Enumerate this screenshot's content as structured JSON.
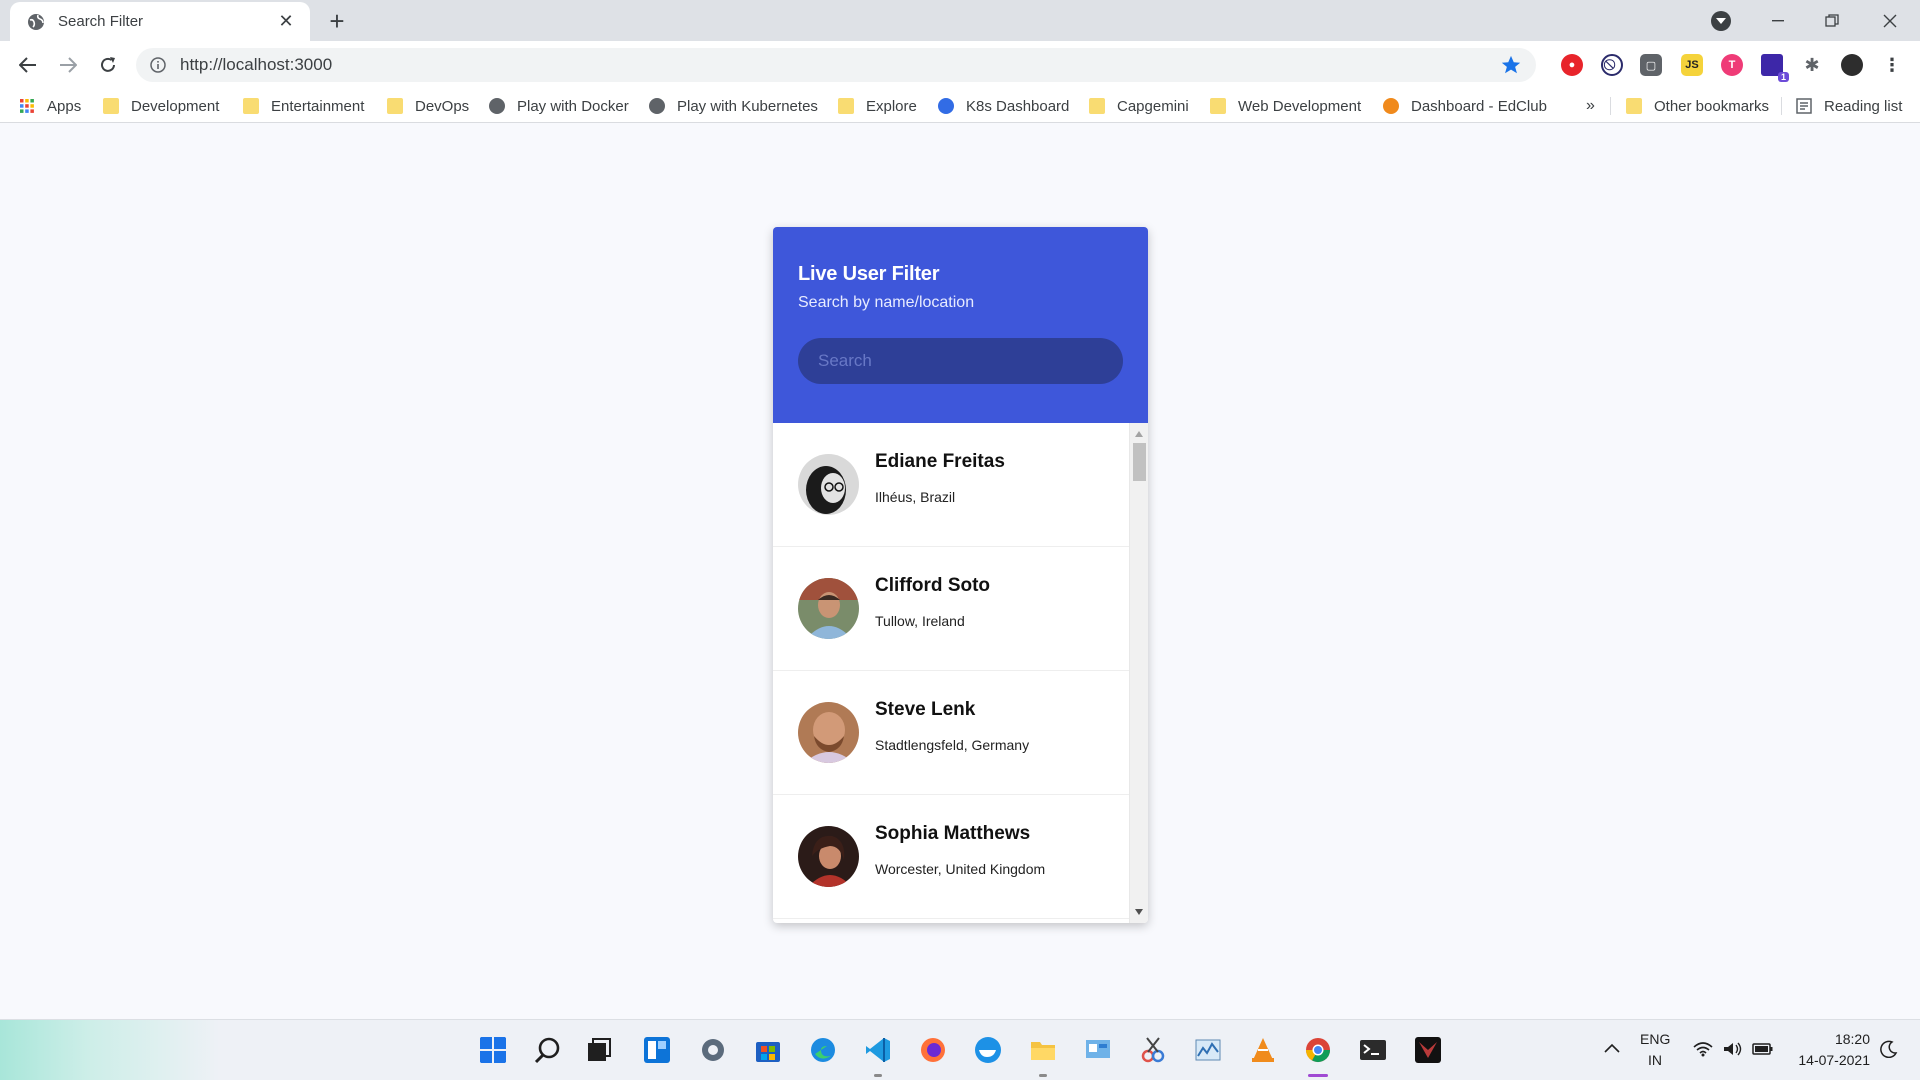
{
  "browser": {
    "tab_title": "Search Filter",
    "url": "http://localhost:3000",
    "bookmarks": [
      "Apps",
      "Development",
      "Entertainment",
      "DevOps",
      "Play with Docker",
      "Play with Kubernetes",
      "Explore",
      "K8s Dashboard",
      "Capgemini",
      "Web Development",
      "Dashboard - EdClub"
    ],
    "more_bookmarks": "»",
    "other_bookmarks": "Other bookmarks",
    "reading_list": "Reading list",
    "extension_badge": "1"
  },
  "filter": {
    "title": "Live User Filter",
    "subtitle": "Search by name/location",
    "search_placeholder": "Search",
    "users": [
      {
        "name": "Ediane Freitas",
        "location": "Ilhéus, Brazil"
      },
      {
        "name": "Clifford Soto",
        "location": "Tullow, Ireland"
      },
      {
        "name": "Steve Lenk",
        "location": "Stadtlengsfeld, Germany"
      },
      {
        "name": "Sophia Matthews",
        "location": "Worcester, United Kingdom"
      }
    ]
  },
  "taskbar": {
    "language": "ENG",
    "region": "IN",
    "time": "18:20",
    "date": "14-07-2021"
  },
  "colors": {
    "header": "#3e57da",
    "search_bg": "#2e3f97",
    "page_bg": "#f8f9fd"
  }
}
